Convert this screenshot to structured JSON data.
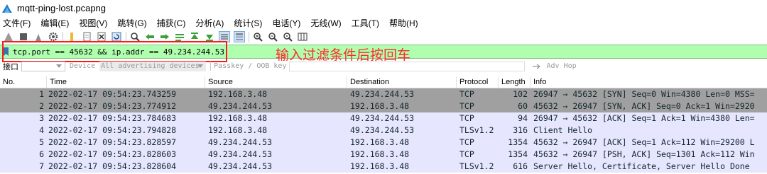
{
  "window": {
    "title": "mqtt-ping-lost.pcapng"
  },
  "menu": [
    "文件(F)",
    "编辑(E)",
    "视图(V)",
    "跳转(G)",
    "捕获(C)",
    "分析(A)",
    "统计(S)",
    "电话(Y)",
    "无线(W)",
    "工具(T)",
    "帮助(H)"
  ],
  "toolbar_icons": [
    "shark-fin-icon",
    "stop-icon",
    "restart-icon",
    "options-gear-icon",
    "open-folder-icon",
    "file-icon",
    "close-file-icon",
    "reload-icon",
    "find-icon",
    "back-arrow-icon",
    "forward-arrow-icon",
    "go-to-packet-icon",
    "first-packet-icon",
    "last-packet-icon",
    "auto-scroll-icon",
    "colorize-icon",
    "zoom-in-icon",
    "zoom-out-icon",
    "normal-size-icon",
    "resize-columns-icon"
  ],
  "filter": {
    "value": "tcp.port == 45632 && ip.addr == 49.234.244.53",
    "annotation": "输入过滤条件后按回车"
  },
  "interface_bar": {
    "interface_label": "接口",
    "device_label": "Device",
    "device_value": "All advertising devices",
    "passkey_label": "Passkey / OOB key",
    "adv_hop_label": "Adv Hop"
  },
  "columns": [
    "No.",
    "Time",
    "Source",
    "Destination",
    "Protocol",
    "Length",
    "Info"
  ],
  "packets": [
    {
      "no": "1",
      "time": "2022-02-17 09:54:23.743259",
      "src": "192.168.3.48",
      "dst": "49.234.244.53",
      "proto": "TCP",
      "len": "102",
      "info": "26947 → 45632 [SYN] Seq=0 Win=4380 Len=0 MSS=",
      "bg": "#a0a0a0"
    },
    {
      "no": "2",
      "time": "2022-02-17 09:54:23.774912",
      "src": "49.234.244.53",
      "dst": "192.168.3.48",
      "proto": "TCP",
      "len": "60",
      "info": "45632 → 26947 [SYN, ACK] Seq=0 Ack=1 Win=2920",
      "bg": "#a0a0a0"
    },
    {
      "no": "3",
      "time": "2022-02-17 09:54:23.784683",
      "src": "192.168.3.48",
      "dst": "49.234.244.53",
      "proto": "TCP",
      "len": "94",
      "info": "26947 → 45632 [ACK] Seq=1 Ack=1 Win=4380 Len=",
      "bg": "#e7e6ff"
    },
    {
      "no": "4",
      "time": "2022-02-17 09:54:23.794828",
      "src": "192.168.3.48",
      "dst": "49.234.244.53",
      "proto": "TLSv1.2",
      "len": "316",
      "info": "Client Hello",
      "bg": "#e7e6ff"
    },
    {
      "no": "5",
      "time": "2022-02-17 09:54:23.828597",
      "src": "49.234.244.53",
      "dst": "192.168.3.48",
      "proto": "TCP",
      "len": "1354",
      "info": "45632 → 26947 [ACK] Seq=1 Ack=112 Win=29200 L",
      "bg": "#e7e6ff"
    },
    {
      "no": "6",
      "time": "2022-02-17 09:54:23.828603",
      "src": "49.234.244.53",
      "dst": "192.168.3.48",
      "proto": "TCP",
      "len": "1354",
      "info": "45632 → 26947 [PSH, ACK] Seq=1301 Ack=112 Win",
      "bg": "#e7e6ff"
    },
    {
      "no": "7",
      "time": "2022-02-17 09:54:23.828604",
      "src": "49.234.244.53",
      "dst": "192.168.3.48",
      "proto": "TLSv1.2",
      "len": "616",
      "info": "Server Hello, Certificate, Server Hello Done",
      "bg": "#e7e6ff"
    }
  ]
}
